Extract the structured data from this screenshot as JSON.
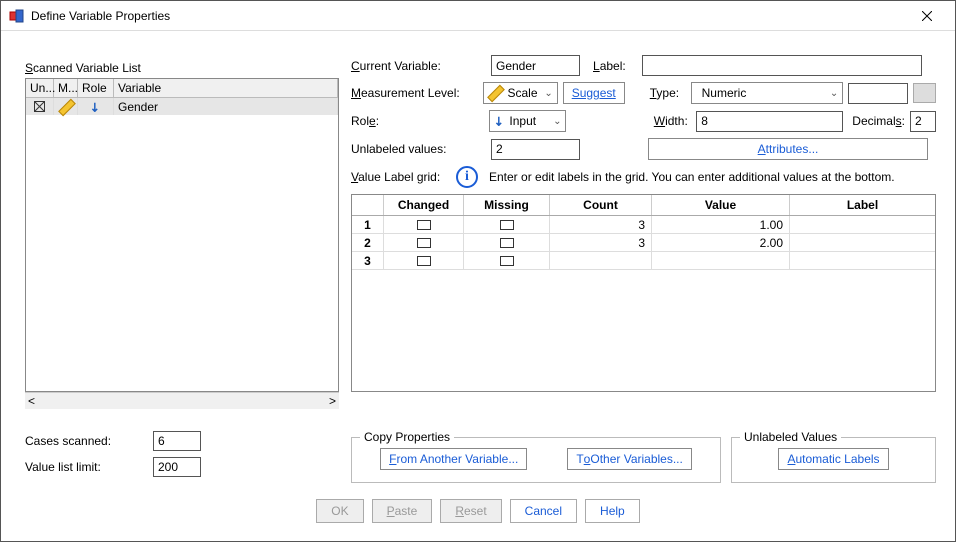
{
  "title": "Define Variable Properties",
  "left": {
    "scanLabel": "Scanned Variable List",
    "headers": {
      "un": "Un...",
      "m": "M...",
      "role": "Role",
      "var": "Variable"
    },
    "rows": [
      {
        "variable": "Gender"
      }
    ],
    "casesScannedLabel": "Cases scanned:",
    "casesScanned": "6",
    "valueListLimitLabel": "Value list limit:",
    "valueListLimit": "200"
  },
  "right": {
    "currentVarLabel": "Current Variable:",
    "currentVar": "Gender",
    "labelLabel": "Label:",
    "labelVal": "",
    "measLevelLabel": "Measurement Level:",
    "measLevel": "Scale",
    "suggest": "Suggest",
    "typeLabel": "Type:",
    "typeVal": "Numeric",
    "roleLabel": "Role:",
    "roleVal": "Input",
    "widthLabel": "Width:",
    "widthVal": "8",
    "decimalsLabel": "Decimals:",
    "decimalsVal": "2",
    "unlabeledLabel": "Unlabeled values:",
    "unlabeledVal": "2",
    "attributes": "Attributes...",
    "gridLabel": "Value Label grid:",
    "gridHint": "Enter or edit labels in the grid. You can enter additional values at the bottom.",
    "gridHeaders": {
      "changed": "Changed",
      "missing": "Missing",
      "count": "Count",
      "value": "Value",
      "label": "Label"
    },
    "gridRows": [
      {
        "n": "1",
        "count": "3",
        "value": "1.00",
        "label": ""
      },
      {
        "n": "2",
        "count": "3",
        "value": "2.00",
        "label": ""
      },
      {
        "n": "3",
        "count": "",
        "value": "",
        "label": ""
      }
    ],
    "copyLegend": "Copy Properties",
    "fromAnother": "From Another Variable...",
    "toOther": "To Other Variables...",
    "unlabeledLegend": "Unlabeled Values",
    "autoLabels": "Automatic Labels"
  },
  "buttons": {
    "ok": "OK",
    "paste": "Paste",
    "reset": "Reset",
    "cancel": "Cancel",
    "help": "Help"
  }
}
